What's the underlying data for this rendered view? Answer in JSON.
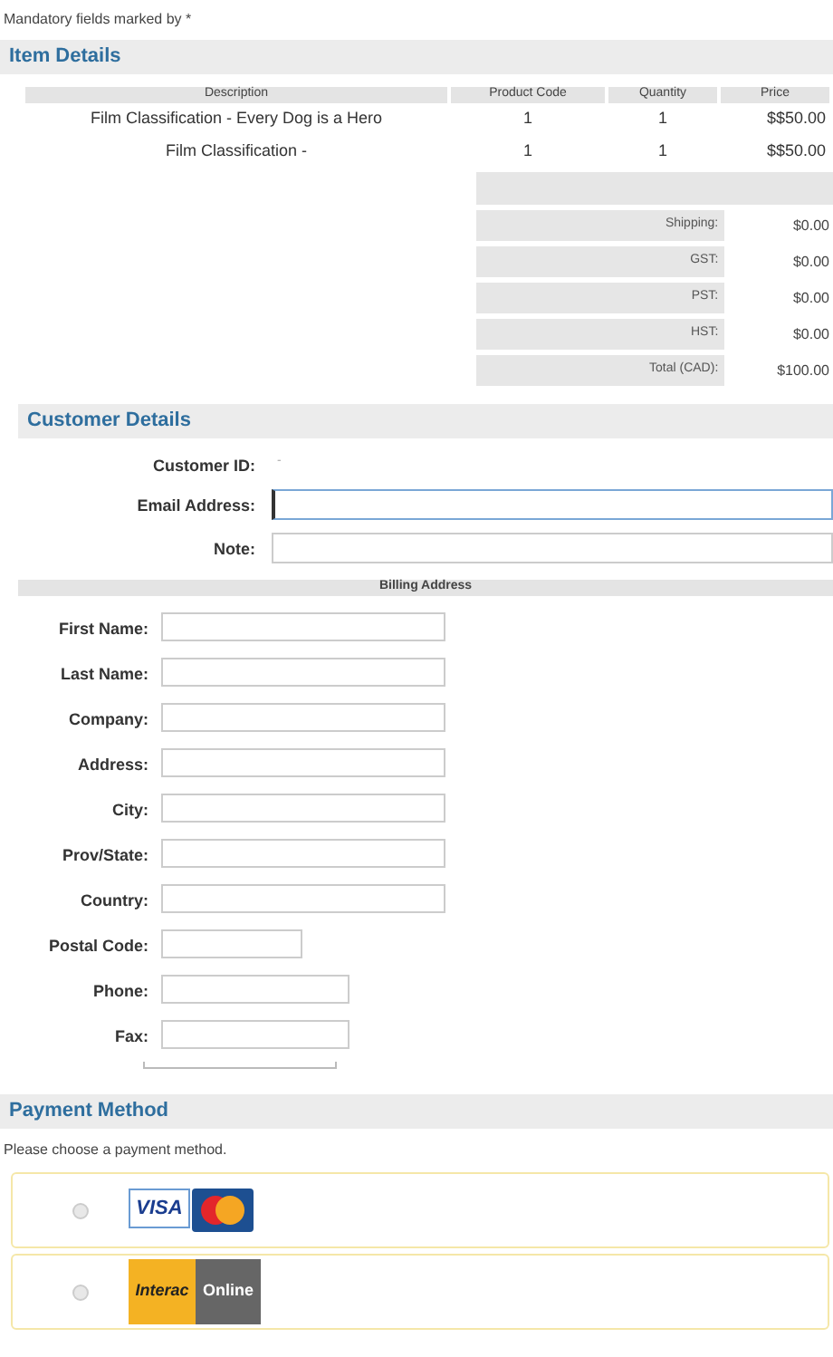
{
  "mandatory_note": "Mandatory fields marked by *",
  "item_details": {
    "title": "Item Details",
    "columns": [
      "Description",
      "Product Code",
      "Quantity",
      "Price"
    ],
    "rows": [
      [
        "Film Classification - Every Dog is a Hero",
        "1",
        "1",
        "$$50.00"
      ],
      [
        "Film Classification -",
        "1",
        "1",
        "$$50.00"
      ]
    ],
    "totals": [
      {
        "label": "Shipping:",
        "value": "$0.00"
      },
      {
        "label": "GST:",
        "value": "$0.00"
      },
      {
        "label": "PST:",
        "value": "$0.00"
      },
      {
        "label": "HST:",
        "value": "$0.00"
      },
      {
        "label": "Total (CAD):",
        "value": "$100.00"
      }
    ]
  },
  "customer_details": {
    "title": "Customer Details",
    "customer_id": {
      "label": "Customer ID:",
      "value": "-"
    },
    "fields": [
      {
        "label": "Email Address:",
        "focused": true
      },
      {
        "label": "Note:",
        "focused": false
      }
    ]
  },
  "billing_address": {
    "title": "Billing Address",
    "fields": [
      {
        "label": "First Name:",
        "kind": "long"
      },
      {
        "label": "Last Name:",
        "kind": "long"
      },
      {
        "label": "Company:",
        "kind": "long"
      },
      {
        "label": "Address:",
        "kind": "long"
      },
      {
        "label": "City:",
        "kind": "long"
      },
      {
        "label": "Prov/State:",
        "kind": "long"
      },
      {
        "label": "Country:",
        "kind": "long"
      },
      {
        "label": "Postal Code:",
        "kind": "short"
      },
      {
        "label": "Phone:",
        "kind": "medium"
      },
      {
        "label": "Fax:",
        "kind": "medium"
      }
    ]
  },
  "payment_method": {
    "title": "Payment Method",
    "prompt": "Please choose a payment method.",
    "options": [
      {
        "kind": "card",
        "selected": false,
        "texts": [
          "VISA"
        ]
      },
      {
        "kind": "interac",
        "selected": false,
        "texts": [
          "Interac",
          "Online"
        ]
      }
    ]
  }
}
